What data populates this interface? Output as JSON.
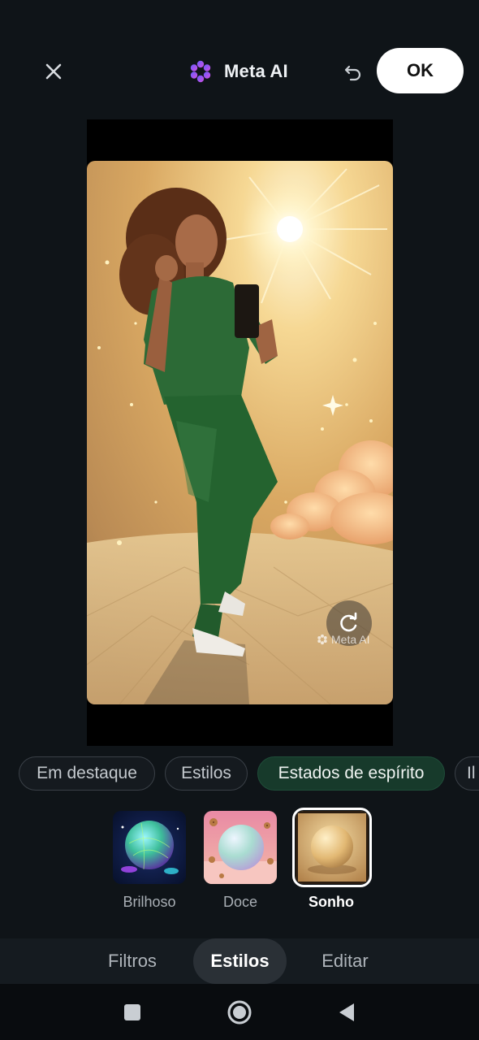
{
  "header": {
    "title": "Meta AI",
    "ok_label": "OK",
    "close_icon": "close-icon",
    "undo_icon": "undo-icon",
    "brand_icon": "meta-ai-flower-icon"
  },
  "preview": {
    "watermark": "Meta AI",
    "regenerate_icon": "refresh-icon"
  },
  "categories": [
    {
      "label": "Em destaque",
      "active": false
    },
    {
      "label": "Estilos",
      "active": false
    },
    {
      "label": "Estados de espírito",
      "active": true
    },
    {
      "label": "Il",
      "active": false
    }
  ],
  "styles": [
    {
      "label": "Brilhoso",
      "selected": false
    },
    {
      "label": "Doce",
      "selected": false
    },
    {
      "label": "Sonho",
      "selected": true
    }
  ],
  "tabs": [
    {
      "label": "Filtros",
      "active": false
    },
    {
      "label": "Estilos",
      "active": true
    },
    {
      "label": "Editar",
      "active": false
    }
  ],
  "colors": {
    "background": "#0f1418",
    "active_chip": "#173a2b",
    "ok_button": "#ffffff"
  }
}
